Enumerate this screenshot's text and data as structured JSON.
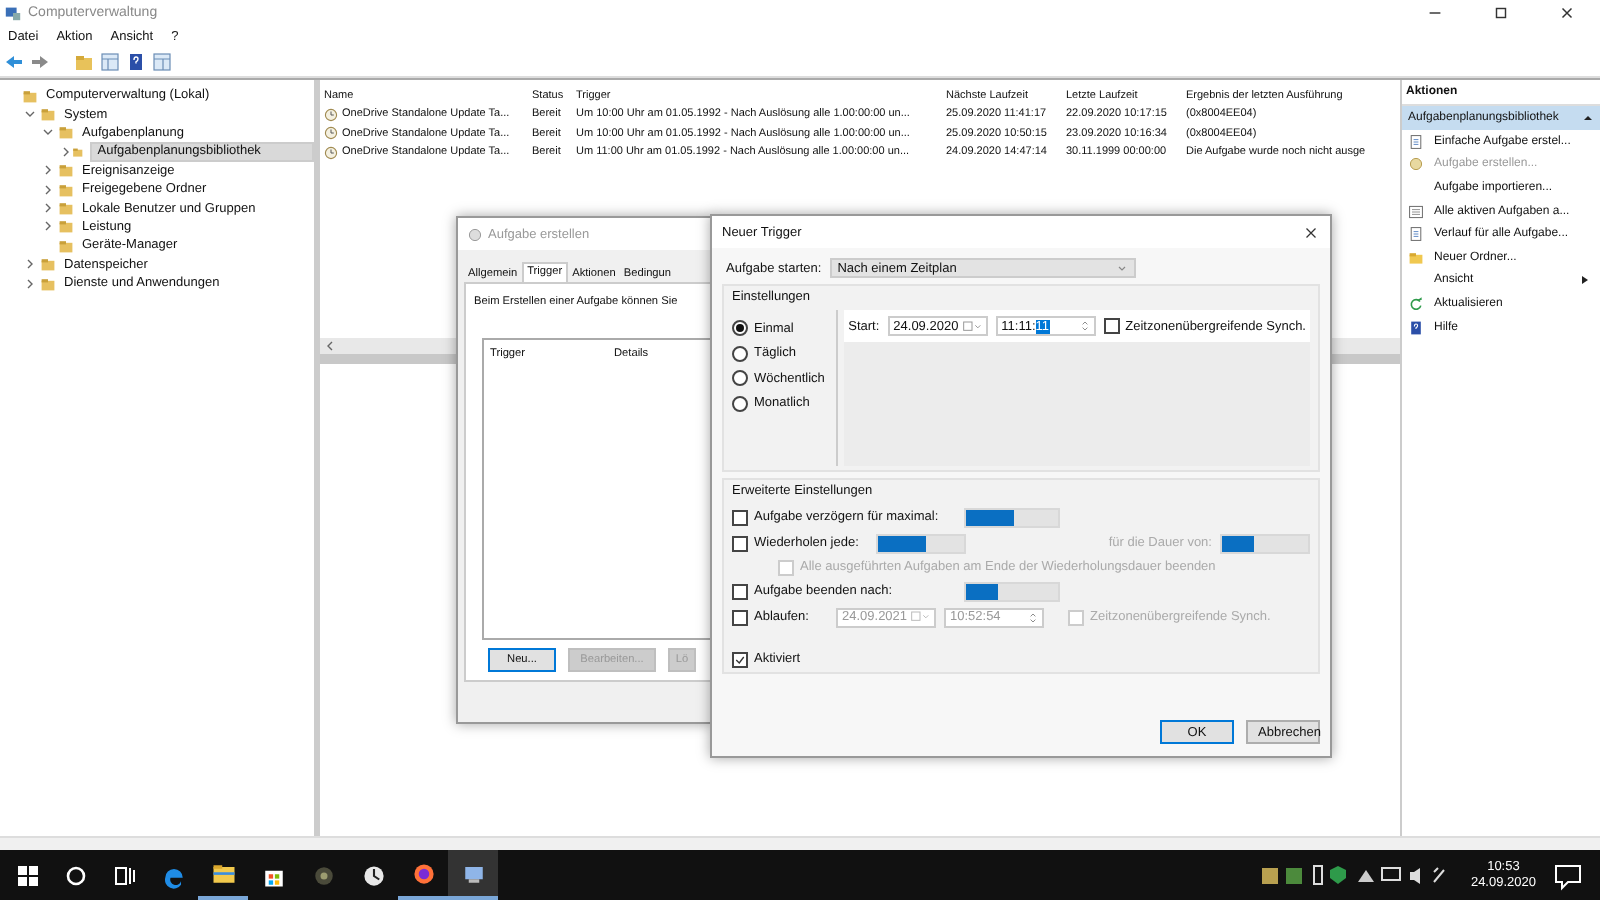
{
  "window": {
    "title": "Computerverwaltung"
  },
  "menu": [
    "Datei",
    "Aktion",
    "Ansicht",
    "?"
  ],
  "tree": [
    {
      "label": "Computerverwaltung (Lokal)",
      "selected": false,
      "children": [
        {
          "label": "System",
          "expanded": true,
          "selected": false,
          "children": [
            {
              "label": "Aufgabenplanung",
              "expanded": true,
              "selected": false,
              "children": [
                {
                  "label": "Aufgabenplanungsbibliothek",
                  "expanded": false,
                  "selected": true
                }
              ]
            },
            {
              "label": "Ereignisanzeige",
              "expanded": false,
              "selected": false
            },
            {
              "label": "Freigegebene Ordner",
              "expanded": false,
              "selected": false
            },
            {
              "label": "Lokale Benutzer und Gruppen",
              "expanded": false,
              "selected": false
            },
            {
              "label": "Leistung",
              "expanded": false,
              "selected": false
            },
            {
              "label": "Geräte-Manager",
              "selected": false
            }
          ]
        },
        {
          "label": "Datenspeicher",
          "expanded": false,
          "selected": false
        },
        {
          "label": "Dienste und Anwendungen",
          "expanded": false,
          "selected": false
        }
      ]
    }
  ],
  "table": {
    "columns": [
      "Name",
      "Status",
      "Trigger",
      "Nächste Laufzeit",
      "Letzte Laufzeit",
      "Ergebnis der letzten Ausführung"
    ],
    "rows": [
      [
        "OneDrive Standalone Update Ta...",
        "Bereit",
        "Um 10:00 Uhr am 01.05.1992 - Nach Auslösung alle 1.00:00:00 un...",
        "25.09.2020 11:41:17",
        "22.09.2020 10:17:15",
        "(0x8004EE04)"
      ],
      [
        "OneDrive Standalone Update Ta...",
        "Bereit",
        "Um 10:00 Uhr am 01.05.1992 - Nach Auslösung alle 1.00:00:00 un...",
        "25.09.2020 10:50:15",
        "23.09.2020 10:16:34",
        "(0x8004EE04)"
      ],
      [
        "OneDrive Standalone Update Ta...",
        "Bereit",
        "Um 11:00 Uhr am 01.05.1992 - Nach Auslösung alle 1.00:00:00 un...",
        "24.09.2020 14:47:14",
        "30.11.1999 00:00:00",
        "Die Aufgabe wurde noch nicht ausge"
      ]
    ]
  },
  "actions": {
    "title": "Aktionen",
    "section": {
      "label": "Aufgabenplanungsbibliothek",
      "expanded": true
    },
    "items": [
      {
        "label": "Einfache Aufgabe erstel...",
        "disabled": false,
        "submenu": false
      },
      {
        "label": "Aufgabe erstellen...",
        "disabled": true,
        "submenu": false
      },
      {
        "label": "Aufgabe importieren...",
        "disabled": false,
        "submenu": false
      },
      {
        "label": "Alle aktiven Aufgaben a...",
        "disabled": false,
        "submenu": false
      },
      {
        "label": "Verlauf für alle Aufgabe...",
        "disabled": false,
        "submenu": false
      },
      {
        "label": "Neuer Ordner...",
        "disabled": false,
        "submenu": false
      },
      {
        "label": "Ansicht",
        "disabled": false,
        "submenu": true
      },
      {
        "label": "Aktualisieren",
        "disabled": false,
        "submenu": false
      },
      {
        "label": "Hilfe",
        "disabled": false,
        "submenu": false
      }
    ]
  },
  "task_dialog": {
    "title": "Aufgabe erstellen",
    "tabs": [
      {
        "label": "Allgemein",
        "selected": false
      },
      {
        "label": "Trigger",
        "selected": true
      },
      {
        "label": "Aktionen",
        "selected": false
      },
      {
        "label": "Bedingun",
        "selected": false
      }
    ],
    "intro": "Beim Erstellen einer Aufgabe können Sie",
    "list_columns": [
      "Trigger",
      "Details"
    ],
    "buttons": [
      {
        "label": "Neu...",
        "disabled": false,
        "focused": true
      },
      {
        "label": "Bearbeiten...",
        "disabled": true,
        "focused": false
      },
      {
        "label": "Lö",
        "disabled": true,
        "focused": false
      }
    ]
  },
  "trigger_dialog": {
    "title": "Neuer Trigger",
    "start_label": "Aufgabe starten:",
    "start_select": {
      "value": "Nach einem Zeitplan",
      "disabled": true
    },
    "settings": {
      "title": "Einstellungen",
      "options": [
        {
          "label": "Einmal",
          "selected": true
        },
        {
          "label": "Täglich",
          "selected": false
        },
        {
          "label": "Wöchentlich",
          "selected": false
        },
        {
          "label": "Monatlich",
          "selected": false
        }
      ],
      "start_label": "Start:",
      "date": "24.09.2020",
      "time": {
        "value": "11:11:",
        "selection": "11"
      },
      "sync": {
        "label": "Zeitzonenübergreifende Synch.",
        "checked": false,
        "disabled": false
      }
    },
    "advanced": {
      "title": "Erweiterte Einstellungen",
      "delay": {
        "label": "Aufgabe verzögern für maximal:",
        "checked": false,
        "disabled": false
      },
      "repeat": {
        "label": "Wiederholen jede:",
        "checked": false,
        "disabled": false
      },
      "duration_label": "für die Dauer von:",
      "stop_all": {
        "label": "Alle ausgeführten Aufgaben am Ende der Wiederholungsdauer beenden",
        "checked": false,
        "disabled": true
      },
      "stop_after": {
        "label": "Aufgabe beenden nach:",
        "checked": false,
        "disabled": false
      },
      "expire": {
        "label": "Ablaufen:",
        "checked": false,
        "disabled": false
      },
      "expire_date": "24.09.2021",
      "expire_time": "10:52:54",
      "expire_sync": {
        "label": "Zeitzonenübergreifende Synch.",
        "checked": false,
        "disabled": true
      }
    },
    "enabled": {
      "label": "Aktiviert",
      "checked": true,
      "disabled": false
    },
    "buttons": [
      {
        "label": "OK",
        "default": true
      },
      {
        "label": "Abbrechen",
        "default": false
      }
    ]
  },
  "taskbar": {
    "apps": [
      {
        "open": false,
        "selected": false
      },
      {
        "open": true,
        "selected": false
      },
      {
        "open": false,
        "selected": false
      },
      {
        "open": false,
        "selected": false
      },
      {
        "open": false,
        "selected": false
      },
      {
        "open": true,
        "selected": false
      },
      {
        "open": true,
        "selected": true
      }
    ],
    "time": "10:53",
    "date": "24.09.2020"
  }
}
